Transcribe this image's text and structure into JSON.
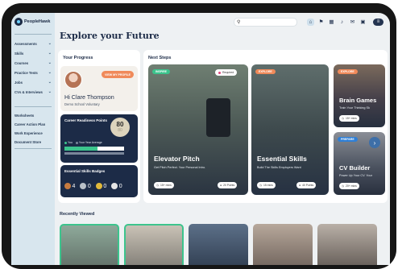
{
  "app": {
    "logo_text": "PeopleHawk"
  },
  "colors": {
    "navy": "#1c2b47",
    "orange": "#f08a5a",
    "green": "#3cc48d",
    "pink": "#e0457c",
    "light_blue": "#d8e6ee"
  },
  "sidebar": {
    "nav": [
      {
        "label": "Assessments"
      },
      {
        "label": "Skills"
      },
      {
        "label": "Courses"
      },
      {
        "label": "Practice Tests"
      },
      {
        "label": "Jobs"
      },
      {
        "label": "CVs & Interviews"
      }
    ],
    "links": [
      {
        "label": "Worksheets"
      },
      {
        "label": "Career Action Plan"
      },
      {
        "label": "Work Experience"
      },
      {
        "label": "Document Store"
      }
    ]
  },
  "topbar": {
    "search_placeholder": "",
    "icons": [
      "home-icon",
      "flag-icon",
      "grid-icon",
      "bell-icon",
      "mail-icon",
      "calendar-icon",
      "menu-icon"
    ]
  },
  "page": {
    "title": "Explore your Future"
  },
  "progress": {
    "title": "Your Progress",
    "view_profile": "VIEW MY PROFILE",
    "greeting": "Hi Clare Thompson",
    "school": "Demo School Voluntary",
    "readiness": {
      "title": "Career Readiness Points",
      "score": "80",
      "score_sub": "80",
      "legend_you": "You",
      "legend_avg": "Your Year Average",
      "you_fraction": 0.55
    },
    "badges": {
      "title": "Essential Skills Badges",
      "items": [
        {
          "icon": "bronze-badge-icon",
          "count": "4",
          "color": "#c77b3f"
        },
        {
          "icon": "silver-badge-icon",
          "count": "0",
          "color": "#b9c0c8"
        },
        {
          "icon": "gold-badge-icon",
          "count": "0",
          "color": "#e2b93b"
        },
        {
          "icon": "platinum-badge-icon",
          "count": "0",
          "color": "#e4e4e4"
        }
      ]
    }
  },
  "next_steps": {
    "title": "Next Steps",
    "tiles": [
      {
        "tag": "INSPIRE",
        "tag_color": "#3cc48d",
        "required": "Required",
        "title": "Elevator Pitch",
        "desc": "Get Pitch Perfect. Your Personal Intro.",
        "duration": "15+ mins",
        "points": "20 Points"
      },
      {
        "tag": "EXPLORE",
        "tag_color": "#f08a5a",
        "title": "Essential Skills",
        "desc": "Build The Skills Employers Want",
        "duration": "15 mins",
        "points": "40 Points"
      },
      {
        "tag": "EXPLORE",
        "tag_color": "#f08a5a",
        "title": "Brain Games",
        "desc": "Train Your Thinking Sk",
        "duration": "15+ mins"
      },
      {
        "tag": "PREPARE",
        "tag_color": "#2f7fd6",
        "title": "CV Builder",
        "desc": "Power Up Your CV. Your",
        "duration": "20+ mins"
      }
    ]
  },
  "recently_viewed": {
    "title": "Recently Viewed"
  }
}
